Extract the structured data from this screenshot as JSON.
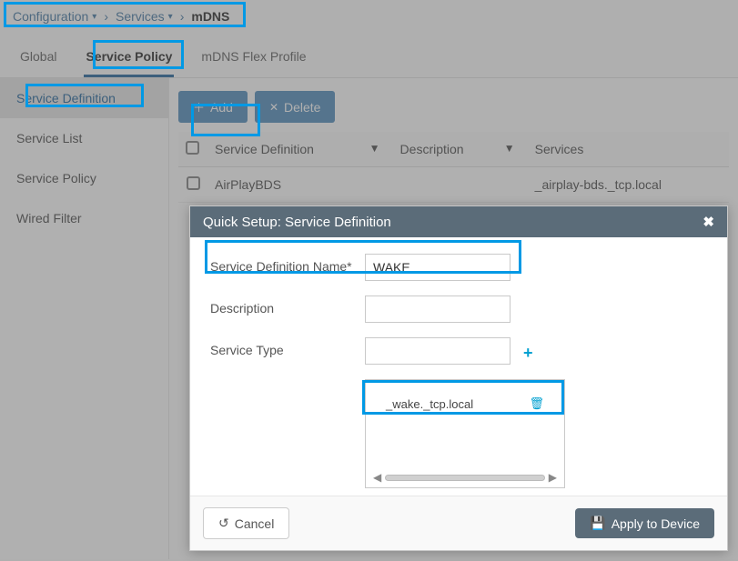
{
  "breadcrumb": {
    "items": [
      "Configuration",
      "Services",
      "mDNS"
    ]
  },
  "top_tabs": {
    "items": [
      "Global",
      "Service Policy",
      "mDNS Flex Profile"
    ],
    "active": "Service Policy"
  },
  "sidebar": {
    "items": [
      "Service Definition",
      "Service List",
      "Service Policy",
      "Wired Filter"
    ],
    "active": "Service Definition"
  },
  "toolbar": {
    "add_label": "Add",
    "delete_label": "Delete"
  },
  "table": {
    "columns": [
      "Service Definition",
      "Description",
      "Services"
    ],
    "rows": [
      {
        "service_definition": "AirPlayBDS",
        "description": "",
        "services": "_airplay-bds._tcp.local"
      }
    ]
  },
  "modal": {
    "title": "Quick Setup: Service Definition",
    "fields": {
      "name_label": "Service Definition Name*",
      "name_value": "WAKE",
      "description_label": "Description",
      "description_value": "",
      "service_type_label": "Service Type",
      "service_type_value": ""
    },
    "service_entries": [
      "_wake._tcp.local"
    ],
    "footer": {
      "cancel_label": "Cancel",
      "apply_label": "Apply to Device"
    }
  }
}
